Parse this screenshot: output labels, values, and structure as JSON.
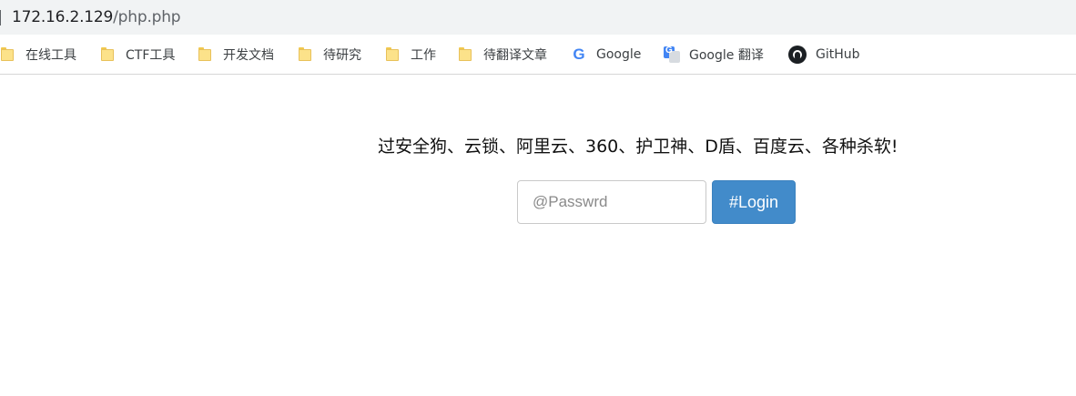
{
  "browser": {
    "url_host": "172.16.2.129",
    "url_path": "/php.php",
    "bookmarks": [
      {
        "label": "在线工具",
        "icon": "folder-icon"
      },
      {
        "label": "CTF工具",
        "icon": "folder-icon"
      },
      {
        "label": "开发文档",
        "icon": "folder-icon"
      },
      {
        "label": "待研究",
        "icon": "folder-icon"
      },
      {
        "label": "工作",
        "icon": "folder-icon"
      },
      {
        "label": "待翻译文章",
        "icon": "folder-icon"
      },
      {
        "label": "Google",
        "icon": "google-icon"
      },
      {
        "label": "Google 翻译",
        "icon": "google-translate-icon"
      },
      {
        "label": "GitHub",
        "icon": "github-icon"
      }
    ]
  },
  "page": {
    "slogan": "过安全狗、云锁、阿里云、360、护卫神、D盾、百度云、各种杀软!",
    "password_placeholder": "@Passwrd",
    "password_value": "",
    "login_label": "#Login"
  },
  "colors": {
    "login_button": "#428bca",
    "url_bar_bg": "#f1f3f4"
  }
}
